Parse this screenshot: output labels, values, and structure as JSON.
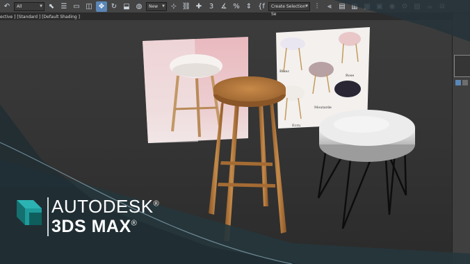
{
  "toolbar": {
    "filter_dropdown": "All",
    "named_set_dropdown": "New",
    "selection_set_placeholder": "Create Selection Se",
    "snap_value": "3",
    "percent_snap": "%"
  },
  "viewport": {
    "label": "ective ] [Standard ] [Default Shading ]"
  },
  "reference_images": {
    "variant_labels": [
      "Blanc",
      "Rose",
      "Moutarde",
      "Ecru"
    ]
  },
  "branding": {
    "line1": "AUTODESK",
    "line2": "3DS MAX",
    "registered": "®"
  },
  "colors": {
    "brand_teal": "#1b8e8e",
    "toolbar_bg": "#444444",
    "viewport_bg": "#3a3a3a",
    "wood": "#b67a3c",
    "seat_white": "#e6e6e6",
    "highlight_blue": "#5a86b8"
  },
  "icons": [
    "select-icon",
    "select-by-name-icon",
    "region-select-icon",
    "window-crossing-icon",
    "move-icon",
    "rotate-icon",
    "scale-icon",
    "link-icon",
    "snap-icon",
    "angle-snap-icon",
    "percent-snap-icon",
    "spinner-snap-icon",
    "mirror-icon",
    "align-icon",
    "layer-icon",
    "scene-explorer-icon",
    "curve-editor-icon",
    "schematic-icon",
    "material-editor-icon",
    "render-setup-icon",
    "render-frame-icon",
    "render-icon"
  ]
}
